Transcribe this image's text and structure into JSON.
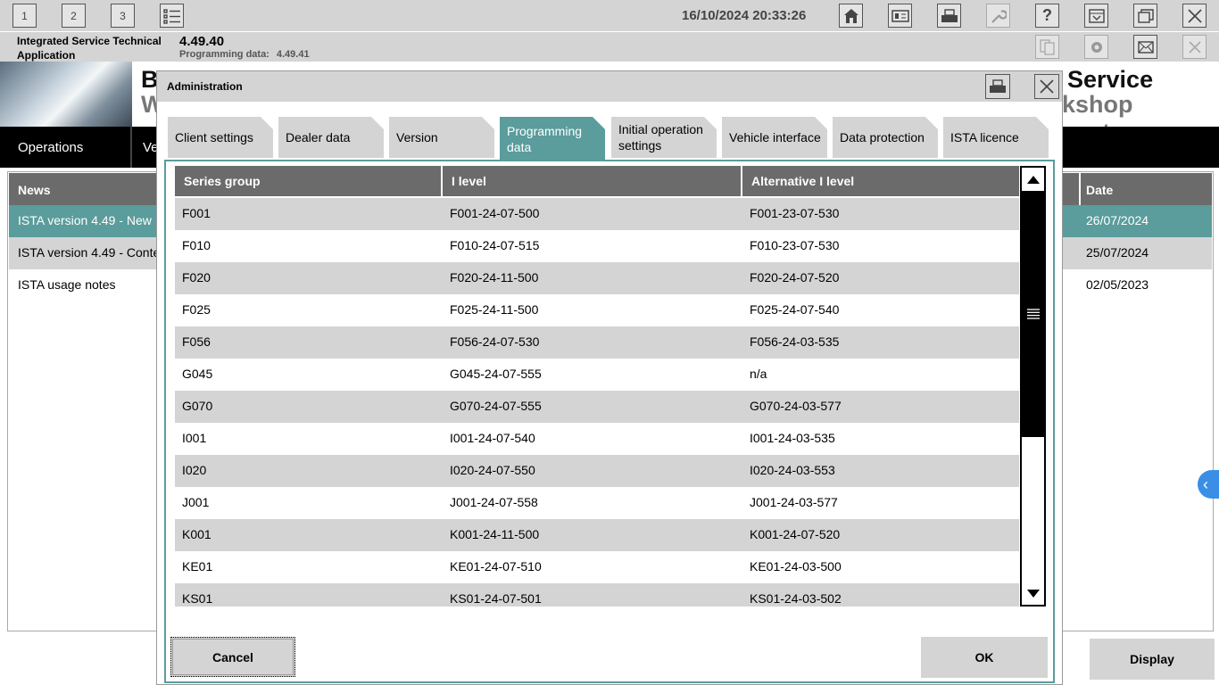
{
  "topbar": {
    "session_buttons": [
      "1",
      "2",
      "3"
    ],
    "datetime": "16/10/2024 20:33:26",
    "icons": [
      "list-icon",
      "home-icon",
      "id-card-icon",
      "print-icon",
      "wrench-icon",
      "help-icon",
      "minimize-icon",
      "restore-icon",
      "close-icon"
    ]
  },
  "infobar": {
    "app_name": "Integrated Service Technical Application",
    "version": "4.49.40",
    "programming_label": "Programming data:",
    "programming_value": "4.49.41"
  },
  "banner": {
    "title_left1": "B",
    "title_left2": "W",
    "title_right1": "Service",
    "title_right2": "kshop system"
  },
  "nav": {
    "operations": "Operations",
    "second": "Ve"
  },
  "news": {
    "header": "News",
    "date_header": "Date",
    "items": [
      {
        "title": "ISTA version 4.49 - New",
        "date": "26/07/2024",
        "selected": true
      },
      {
        "title": "ISTA version 4.49 - Conte",
        "date": "25/07/2024",
        "selected": false
      },
      {
        "title": "ISTA usage notes",
        "date": "02/05/2023",
        "selected": false
      }
    ],
    "display_button": "Display"
  },
  "modal": {
    "title": "Administration",
    "tabs": [
      {
        "label": "Client settings",
        "active": false
      },
      {
        "label": "Dealer data",
        "active": false
      },
      {
        "label": "Version",
        "active": false
      },
      {
        "label": "Programming data",
        "active": true
      },
      {
        "label": "Initial operation settings",
        "active": false
      },
      {
        "label": "Vehicle interface",
        "active": false
      },
      {
        "label": "Data protection",
        "active": false
      },
      {
        "label": "ISTA licence",
        "active": false
      }
    ],
    "columns": [
      "Series group",
      "I level",
      "Alternative I level"
    ],
    "rows": [
      [
        "F001",
        "F001-24-07-500",
        "F001-23-07-530"
      ],
      [
        "F010",
        "F010-24-07-515",
        "F010-23-07-530"
      ],
      [
        "F020",
        "F020-24-11-500",
        "F020-24-07-520"
      ],
      [
        "F025",
        "F025-24-11-500",
        "F025-24-07-540"
      ],
      [
        "F056",
        "F056-24-07-530",
        "F056-24-03-535"
      ],
      [
        "G045",
        "G045-24-07-555",
        "n/a"
      ],
      [
        "G070",
        "G070-24-07-555",
        "G070-24-03-577"
      ],
      [
        "I001",
        "I001-24-07-540",
        "I001-24-03-535"
      ],
      [
        "I020",
        "I020-24-07-550",
        "I020-24-03-553"
      ],
      [
        "J001",
        "J001-24-07-558",
        "J001-24-03-577"
      ],
      [
        "K001",
        "K001-24-11-500",
        "K001-24-07-520"
      ],
      [
        "KE01",
        "KE01-24-07-510",
        "KE01-24-03-500"
      ],
      [
        "KS01",
        "KS01-24-07-501",
        "KS01-24-03-502"
      ]
    ],
    "cancel_label": "Cancel",
    "ok_label": "OK"
  }
}
